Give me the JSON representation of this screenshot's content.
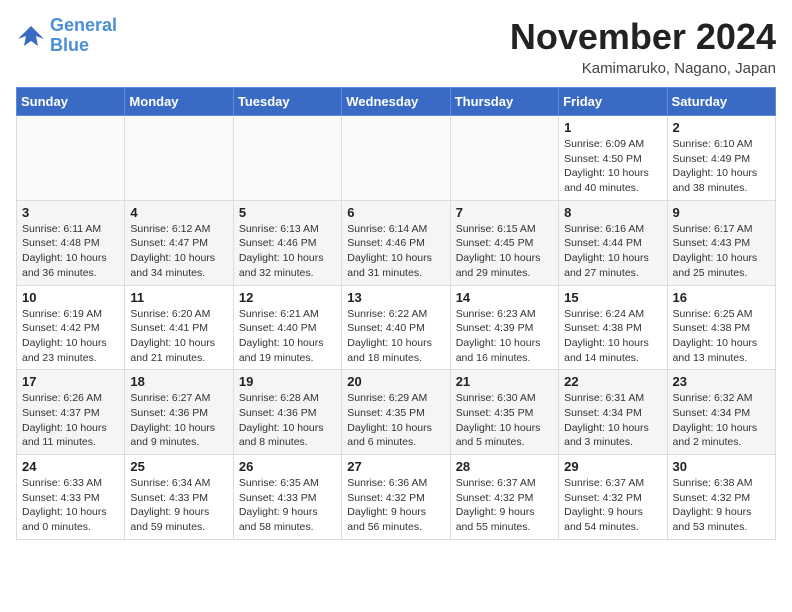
{
  "logo": {
    "line1": "General",
    "line2": "Blue"
  },
  "title": "November 2024",
  "location": "Kamimaruko, Nagano, Japan",
  "weekdays": [
    "Sunday",
    "Monday",
    "Tuesday",
    "Wednesday",
    "Thursday",
    "Friday",
    "Saturday"
  ],
  "weeks": [
    [
      {
        "day": "",
        "detail": ""
      },
      {
        "day": "",
        "detail": ""
      },
      {
        "day": "",
        "detail": ""
      },
      {
        "day": "",
        "detail": ""
      },
      {
        "day": "",
        "detail": ""
      },
      {
        "day": "1",
        "detail": "Sunrise: 6:09 AM\nSunset: 4:50 PM\nDaylight: 10 hours\nand 40 minutes."
      },
      {
        "day": "2",
        "detail": "Sunrise: 6:10 AM\nSunset: 4:49 PM\nDaylight: 10 hours\nand 38 minutes."
      }
    ],
    [
      {
        "day": "3",
        "detail": "Sunrise: 6:11 AM\nSunset: 4:48 PM\nDaylight: 10 hours\nand 36 minutes."
      },
      {
        "day": "4",
        "detail": "Sunrise: 6:12 AM\nSunset: 4:47 PM\nDaylight: 10 hours\nand 34 minutes."
      },
      {
        "day": "5",
        "detail": "Sunrise: 6:13 AM\nSunset: 4:46 PM\nDaylight: 10 hours\nand 32 minutes."
      },
      {
        "day": "6",
        "detail": "Sunrise: 6:14 AM\nSunset: 4:46 PM\nDaylight: 10 hours\nand 31 minutes."
      },
      {
        "day": "7",
        "detail": "Sunrise: 6:15 AM\nSunset: 4:45 PM\nDaylight: 10 hours\nand 29 minutes."
      },
      {
        "day": "8",
        "detail": "Sunrise: 6:16 AM\nSunset: 4:44 PM\nDaylight: 10 hours\nand 27 minutes."
      },
      {
        "day": "9",
        "detail": "Sunrise: 6:17 AM\nSunset: 4:43 PM\nDaylight: 10 hours\nand 25 minutes."
      }
    ],
    [
      {
        "day": "10",
        "detail": "Sunrise: 6:19 AM\nSunset: 4:42 PM\nDaylight: 10 hours\nand 23 minutes."
      },
      {
        "day": "11",
        "detail": "Sunrise: 6:20 AM\nSunset: 4:41 PM\nDaylight: 10 hours\nand 21 minutes."
      },
      {
        "day": "12",
        "detail": "Sunrise: 6:21 AM\nSunset: 4:40 PM\nDaylight: 10 hours\nand 19 minutes."
      },
      {
        "day": "13",
        "detail": "Sunrise: 6:22 AM\nSunset: 4:40 PM\nDaylight: 10 hours\nand 18 minutes."
      },
      {
        "day": "14",
        "detail": "Sunrise: 6:23 AM\nSunset: 4:39 PM\nDaylight: 10 hours\nand 16 minutes."
      },
      {
        "day": "15",
        "detail": "Sunrise: 6:24 AM\nSunset: 4:38 PM\nDaylight: 10 hours\nand 14 minutes."
      },
      {
        "day": "16",
        "detail": "Sunrise: 6:25 AM\nSunset: 4:38 PM\nDaylight: 10 hours\nand 13 minutes."
      }
    ],
    [
      {
        "day": "17",
        "detail": "Sunrise: 6:26 AM\nSunset: 4:37 PM\nDaylight: 10 hours\nand 11 minutes."
      },
      {
        "day": "18",
        "detail": "Sunrise: 6:27 AM\nSunset: 4:36 PM\nDaylight: 10 hours\nand 9 minutes."
      },
      {
        "day": "19",
        "detail": "Sunrise: 6:28 AM\nSunset: 4:36 PM\nDaylight: 10 hours\nand 8 minutes."
      },
      {
        "day": "20",
        "detail": "Sunrise: 6:29 AM\nSunset: 4:35 PM\nDaylight: 10 hours\nand 6 minutes."
      },
      {
        "day": "21",
        "detail": "Sunrise: 6:30 AM\nSunset: 4:35 PM\nDaylight: 10 hours\nand 5 minutes."
      },
      {
        "day": "22",
        "detail": "Sunrise: 6:31 AM\nSunset: 4:34 PM\nDaylight: 10 hours\nand 3 minutes."
      },
      {
        "day": "23",
        "detail": "Sunrise: 6:32 AM\nSunset: 4:34 PM\nDaylight: 10 hours\nand 2 minutes."
      }
    ],
    [
      {
        "day": "24",
        "detail": "Sunrise: 6:33 AM\nSunset: 4:33 PM\nDaylight: 10 hours\nand 0 minutes."
      },
      {
        "day": "25",
        "detail": "Sunrise: 6:34 AM\nSunset: 4:33 PM\nDaylight: 9 hours\nand 59 minutes."
      },
      {
        "day": "26",
        "detail": "Sunrise: 6:35 AM\nSunset: 4:33 PM\nDaylight: 9 hours\nand 58 minutes."
      },
      {
        "day": "27",
        "detail": "Sunrise: 6:36 AM\nSunset: 4:32 PM\nDaylight: 9 hours\nand 56 minutes."
      },
      {
        "day": "28",
        "detail": "Sunrise: 6:37 AM\nSunset: 4:32 PM\nDaylight: 9 hours\nand 55 minutes."
      },
      {
        "day": "29",
        "detail": "Sunrise: 6:37 AM\nSunset: 4:32 PM\nDaylight: 9 hours\nand 54 minutes."
      },
      {
        "day": "30",
        "detail": "Sunrise: 6:38 AM\nSunset: 4:32 PM\nDaylight: 9 hours\nand 53 minutes."
      }
    ]
  ]
}
